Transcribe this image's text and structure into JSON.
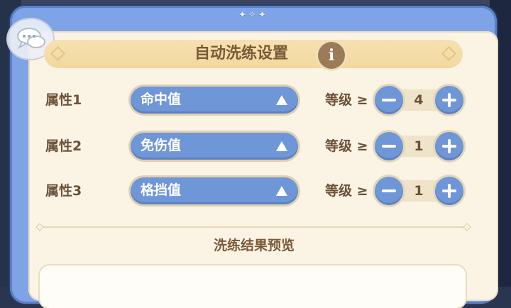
{
  "panel": {
    "title": "自动洗练设置",
    "info_glyph": "i",
    "top_ornament": "✦✧✦"
  },
  "rows": [
    {
      "label": "属性1",
      "attribute": "命中值",
      "level_label": "等级 ≥",
      "level": "4"
    },
    {
      "label": "属性2",
      "attribute": "免伤值",
      "level_label": "等级 ≥",
      "level": "1"
    },
    {
      "label": "属性3",
      "attribute": "格挡值",
      "level_label": "等级 ≥",
      "level": "1"
    }
  ],
  "preview": {
    "title": "洗练结果预览"
  },
  "icons": {
    "chat": "chat-bubble-icon",
    "info": "info-icon",
    "dropdown": "triangle-up-icon",
    "minus": "minus-icon",
    "plus": "plus-icon"
  },
  "colors": {
    "accent_blue": "#6f96d6",
    "frame_blue": "#7ea3e6",
    "panel_cream": "#fbf4e4",
    "title_bar": "#f2d89f",
    "text_brown": "#6b5138"
  }
}
